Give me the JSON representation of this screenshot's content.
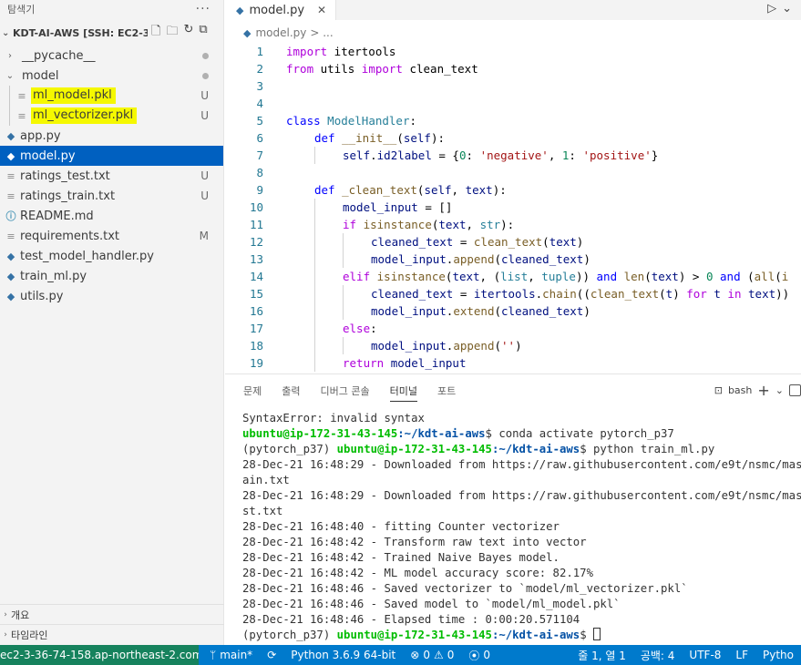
{
  "explorer": {
    "title": "탐색기",
    "more": "···",
    "root": "KDT-AI-AWS [SSH: EC2-3...",
    "items": [
      {
        "label": "__pycache__",
        "type": "folder",
        "status": "dot"
      },
      {
        "label": "model",
        "type": "folder-open",
        "status": "dot"
      },
      {
        "label": "ml_model.pkl",
        "type": "file",
        "status": "U"
      },
      {
        "label": "ml_vectorizer.pkl",
        "type": "file",
        "status": "U"
      },
      {
        "label": "app.py",
        "type": "py",
        "status": ""
      },
      {
        "label": "model.py",
        "type": "py",
        "status": ""
      },
      {
        "label": "ratings_test.txt",
        "type": "txt",
        "status": "U"
      },
      {
        "label": "ratings_train.txt",
        "type": "txt",
        "status": "U"
      },
      {
        "label": "README.md",
        "type": "md",
        "status": ""
      },
      {
        "label": "requirements.txt",
        "type": "txt",
        "status": "M"
      },
      {
        "label": "test_model_handler.py",
        "type": "py",
        "status": ""
      },
      {
        "label": "train_ml.py",
        "type": "py",
        "status": ""
      },
      {
        "label": "utils.py",
        "type": "py",
        "status": ""
      }
    ],
    "outline": "개요",
    "timeline": "타임라인"
  },
  "editor": {
    "tab": "model.py",
    "breadcrumb_file": "model.py",
    "breadcrumb_rest": "> ...",
    "line_numbers": [
      "1",
      "2",
      "3",
      "4",
      "5",
      "6",
      "7",
      "8",
      "9",
      "10",
      "11",
      "12",
      "13",
      "14",
      "15",
      "16",
      "17",
      "18",
      "19"
    ]
  },
  "panel": {
    "tabs": [
      "문제",
      "출력",
      "디버그 콘솔",
      "터미널",
      "포트"
    ],
    "active_tab": "터미널",
    "shell": "bash",
    "terminal": {
      "l1": "SyntaxError: invalid syntax",
      "prompt": "ubuntu@ip-172-31-43-145",
      "path": ":~/kdt-ai-aws",
      "cmd1": "$ conda activate pytorch_p37",
      "env": "(pytorch_p37) ",
      "cmd2": "$ python train_ml.py",
      "l4": "28-Dec-21 16:48:29 - Downloaded from https://raw.githubusercontent.com/e9t/nsmc/master/r",
      "l5": "ain.txt",
      "l6": "28-Dec-21 16:48:29 - Downloaded from https://raw.githubusercontent.com/e9t/nsmc/master/r",
      "l7": "st.txt",
      "l8": "28-Dec-21 16:48:40 - fitting Counter vectorizer",
      "l9": "28-Dec-21 16:48:42 - Transform raw text into vector",
      "l10": "28-Dec-21 16:48:42 - Trained Naive Bayes model.",
      "l11": "28-Dec-21 16:48:42 - ML model accuracy score: 82.17%",
      "l12": "28-Dec-21 16:48:46 - Saved vectorizer to `model/ml_vectorizer.pkl`",
      "l13": "28-Dec-21 16:48:46 - Saved model to `model/ml_model.pkl`",
      "l14": "28-Dec-21 16:48:46 - Elapsed time : 0:00:20.571104",
      "cmd3": "$ "
    }
  },
  "statusbar": {
    "remote": "ec2-3-36-74-158.ap-northeast-2.comp...",
    "branch": "main*",
    "python": "Python 3.6.9 64-bit",
    "errors": "0",
    "warnings": "0",
    "ports": "0",
    "position": "줄 1, 열 1",
    "spaces": "공백: 4",
    "encoding": "UTF-8",
    "eol": "LF",
    "language": "Pytho"
  },
  "colors": {
    "statusbar": "#007acc",
    "remote": "#16825d",
    "selection": "#0060c0",
    "highlight": "#f5f800"
  }
}
